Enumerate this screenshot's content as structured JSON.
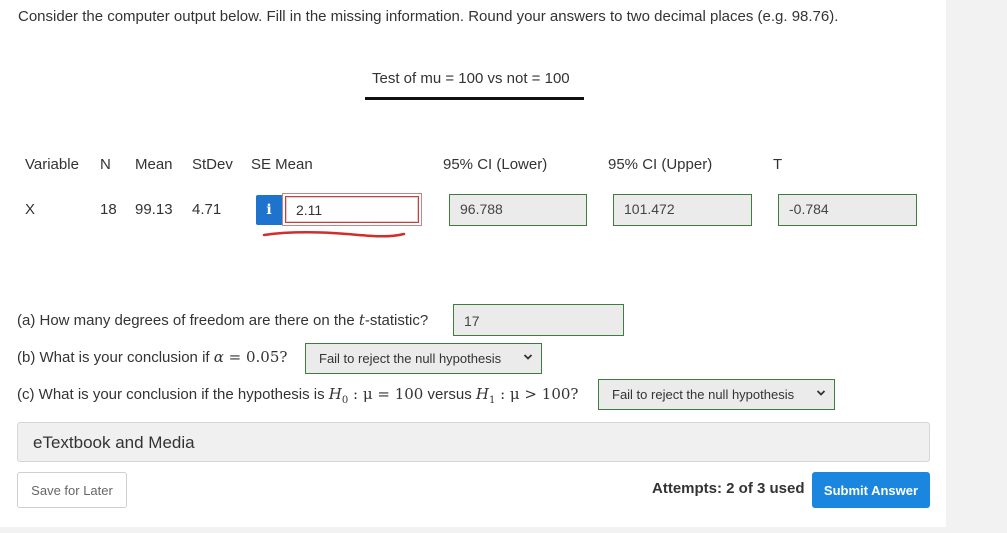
{
  "prompt": "Consider the computer output below. Fill in the missing information. Round your answers to two decimal places (e.g. 98.76).",
  "test_title": "Test of mu = 100 vs not = 100",
  "table": {
    "headers": {
      "variable": "Variable",
      "n": "N",
      "mean": "Mean",
      "stdev": "StDev",
      "se_mean": "SE Mean",
      "ci_lower": "95% CI (Lower)",
      "ci_upper": "95% CI (Upper)",
      "t": "T"
    },
    "row": {
      "variable": "X",
      "n": "18",
      "mean": "99.13",
      "stdev": "4.71",
      "se_mean": "2.11",
      "ci_lower": "96.788",
      "ci_upper": "101.472",
      "t": "-0.784"
    },
    "info_icon": "i"
  },
  "questions": {
    "a": {
      "text_before": "(a) How many degrees of freedom are there on the ",
      "italic": "t",
      "text_after": "-statistic?",
      "answer": "17"
    },
    "b": {
      "text_before": "(b) What is your conclusion if ",
      "alpha": "α",
      "equals": " = 0.05?",
      "selected": "Fail to reject the null hypothesis"
    },
    "c": {
      "text_before": "(c) What is your conclusion if the hypothesis is ",
      "h0": "H",
      "h0_sub": "0",
      "h0_rest": " : μ = 100",
      "versus": " versus ",
      "h1": "H",
      "h1_sub": "1",
      "h1_rest": " : μ > 100?",
      "selected": "Fail to reject the null hypothesis"
    }
  },
  "etextbook_label": "eTextbook and Media",
  "save_label": "Save for Later",
  "attempts_label": "Attempts: 2 of 3 used",
  "submit_label": "Submit Answer",
  "icons": {
    "info": "info-icon",
    "chevron": "chevron-down-icon"
  },
  "colors": {
    "accent": "#1a86e0",
    "correct_border": "#3d7d3d",
    "error_border": "#b94444",
    "annotation": "#d42b2b"
  }
}
